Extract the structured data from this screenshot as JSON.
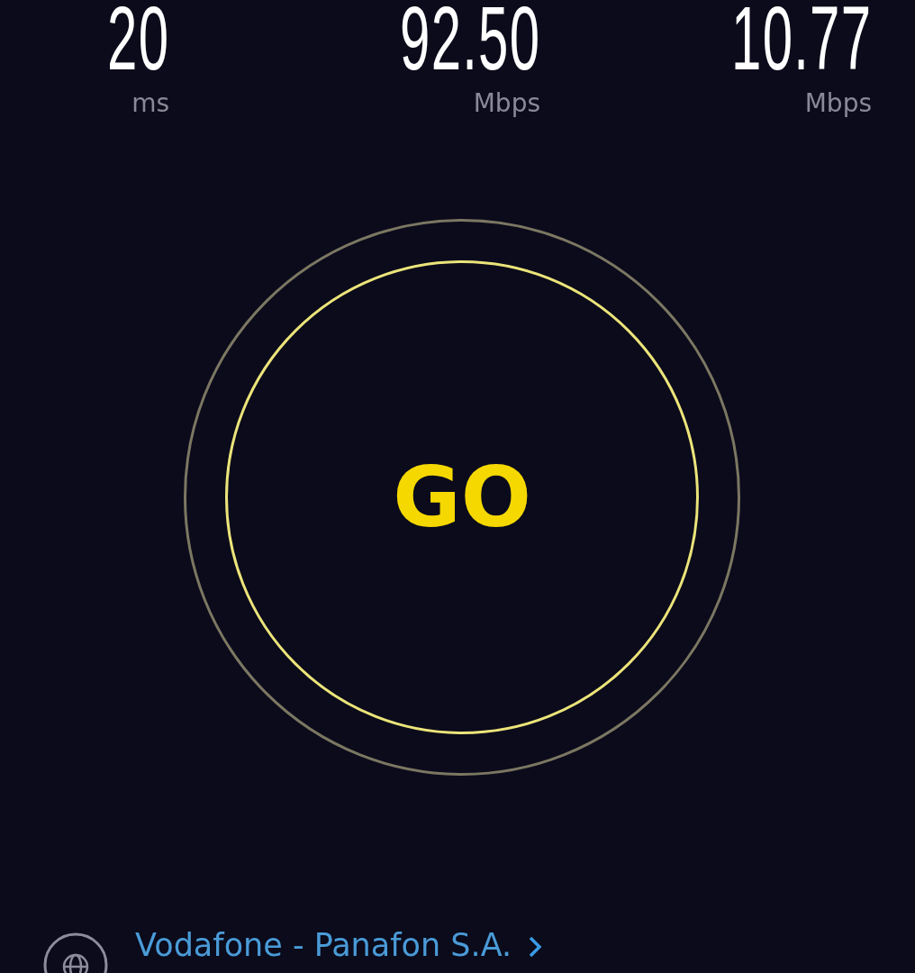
{
  "metrics": [
    {
      "value": "20",
      "unit": "ms"
    },
    {
      "value": "92.50",
      "unit": "Mbps"
    },
    {
      "value": "10.77",
      "unit": "Mbps"
    }
  ],
  "start_button": {
    "label": "GO"
  },
  "provider": {
    "name": "Vodafone - Panafon S.A."
  }
}
